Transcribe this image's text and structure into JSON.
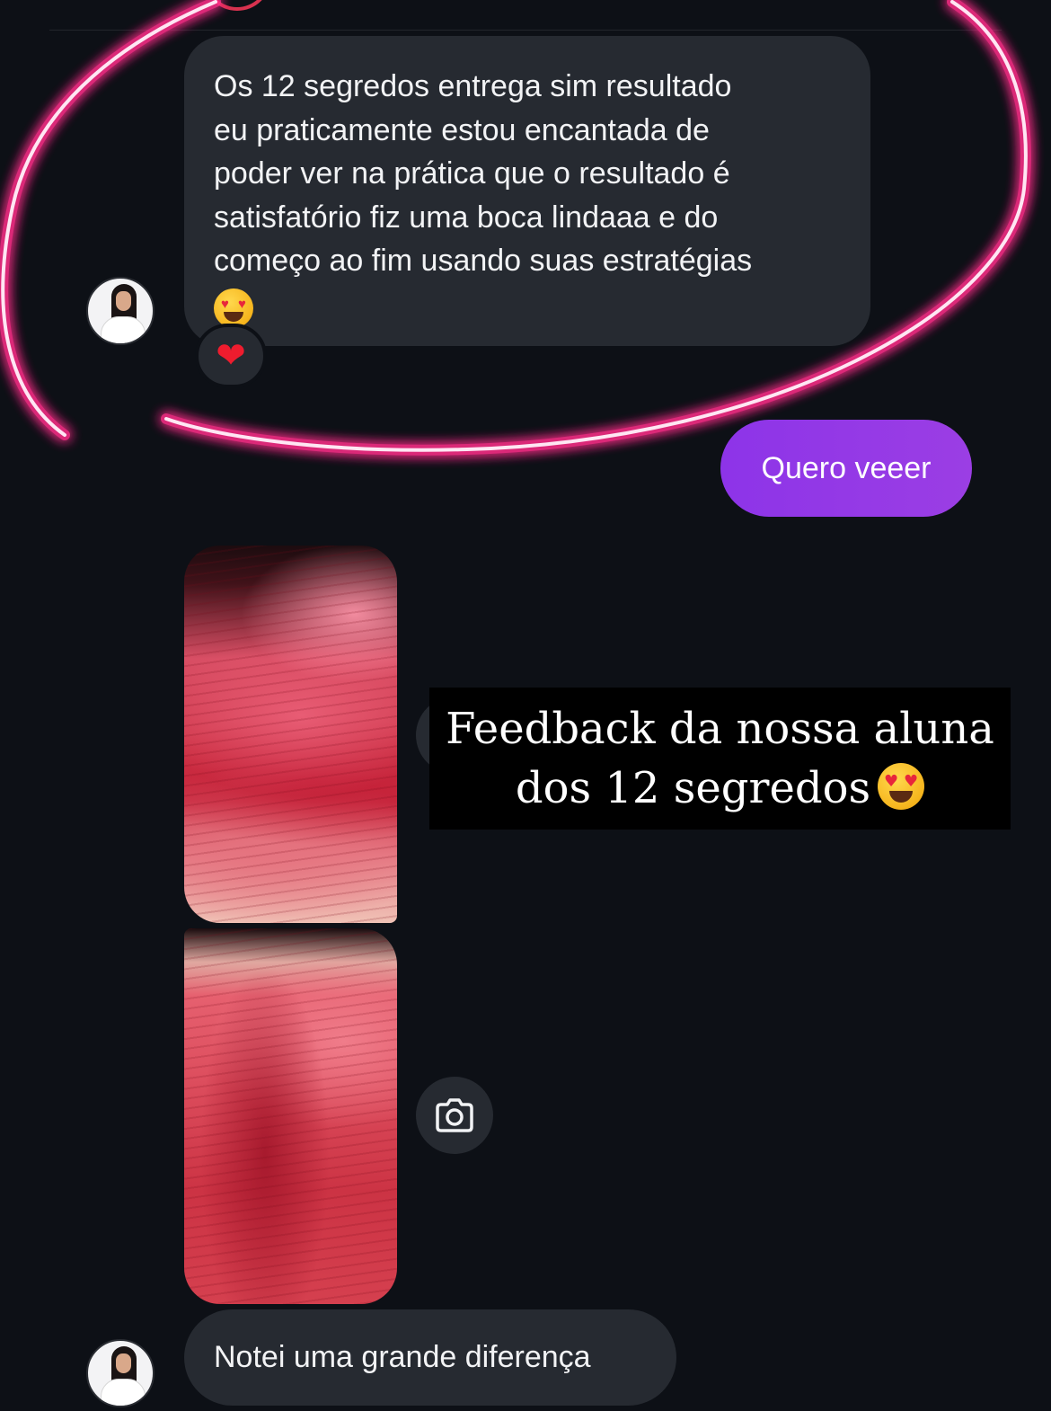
{
  "chat": {
    "message_1": {
      "text": "Os 12 segredos entrega sim resultado\neu  praticamente estou encantada de\npoder ver na prática que o resultado é\nsatisfatório fiz uma boca lindaaa e do\ncomeço ao fim usando suas estratégias",
      "emoji": "heart-eyes-emoji",
      "reaction": "❤"
    },
    "sent_message": {
      "text": "Quero veeer"
    },
    "overlay_caption": {
      "line_1": "Feedback da nossa aluna",
      "line_2": "dos 12 segredos"
    },
    "message_2": {
      "text": "Notei uma grande diferença"
    },
    "icons": [
      "avatar",
      "heart-icon",
      "camera-icon",
      "heart-eyes-emoji"
    ],
    "colors": {
      "background": "#0d1016",
      "received_bubble": "#262a31",
      "sent_bubble": "#9339e6",
      "neon_ring": "#ff2d8a",
      "reaction_heart": "#ee1c2e"
    }
  }
}
